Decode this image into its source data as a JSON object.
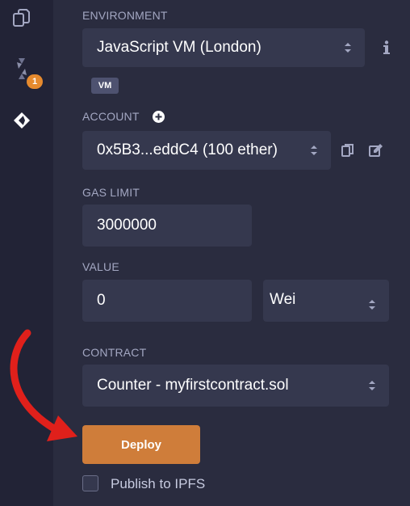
{
  "sidebar": {
    "icons": [
      "file-explorer-icon",
      "solidity-compiler-icon",
      "deploy-run-icon"
    ],
    "compiler_badge": "1"
  },
  "environment": {
    "label": "ENVIRONMENT",
    "value": "JavaScript VM (London)",
    "chip": "VM",
    "info_icon": "info-icon"
  },
  "account": {
    "label": "ACCOUNT",
    "value": "0x5B3...eddC4 (100 ether)"
  },
  "gas_limit": {
    "label": "GAS LIMIT",
    "value": "3000000"
  },
  "value": {
    "label": "VALUE",
    "amount": "0",
    "unit": "Wei"
  },
  "contract": {
    "label": "CONTRACT",
    "value": "Counter - myfirstcontract.sol"
  },
  "deploy": {
    "label": "Deploy"
  },
  "publish": {
    "label": "Publish to IPFS",
    "checked": false
  },
  "colors": {
    "background": "#2a2c3f",
    "sidebar": "#222336",
    "field": "#35384e",
    "deploy_button": "#cf7d3a",
    "annotation_arrow": "#e0201b",
    "badge": "#e68a2e"
  }
}
